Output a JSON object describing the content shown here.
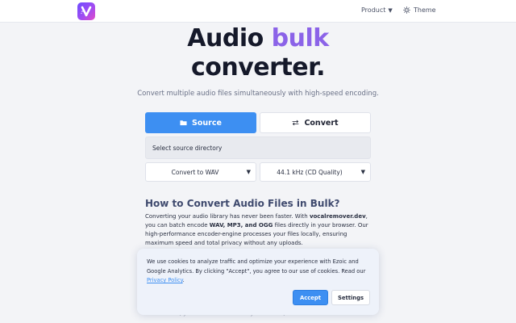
{
  "header": {
    "logo_letter": "V",
    "nav": {
      "product_label": "Product",
      "theme_label": "Theme"
    }
  },
  "hero": {
    "title_part1": "Audio ",
    "title_accent": "bulk",
    "title_part2": "converter.",
    "subtitle": "Convert multiple audio files simultaneously with high-speed encoding."
  },
  "tabs": {
    "source_label": "Source",
    "convert_label": "Convert"
  },
  "source": {
    "directory_label": "Select source directory"
  },
  "options": {
    "format_value": "Convert to WAV",
    "rate_value": "44.1 kHz (CD Quality)"
  },
  "article": {
    "heading": "How to Convert Audio Files in Bulk?",
    "p1_a": "Converting your audio library has never been faster. With ",
    "p1_site": "vocalremover.dev",
    "p1_b": ", you can batch encode ",
    "p1_formats": "WAV, MP3, and OGG",
    "p1_c": " files directly in your browser. Our high-performance encoder-engine processes your files locally, ensuring maximum speed and total privacy without any uploads.",
    "p2_fragment": "ur ... files, your data never leaves your device, and the conversion"
  },
  "cookie": {
    "text": "We use cookies to analyze traffic and optimize your experience with Ezoic and Google Analytics. By clicking \"Accept\", you agree to our use of cookies. Read our ",
    "link_label": "Privacy Policy",
    "text_end": ".",
    "accept_label": "Accept",
    "settings_label": "Settings"
  },
  "colors": {
    "primary": "#3d8ff2",
    "accent_purple": "#8b63e8",
    "heading_dark": "#15192a"
  },
  "icons": {
    "logo": "v-logo-icon",
    "product_caret": "caret-down-icon",
    "theme": "sun-icon",
    "source": "folder-icon",
    "convert": "swap-arrows-icon",
    "select_caret": "caret-down-icon"
  }
}
